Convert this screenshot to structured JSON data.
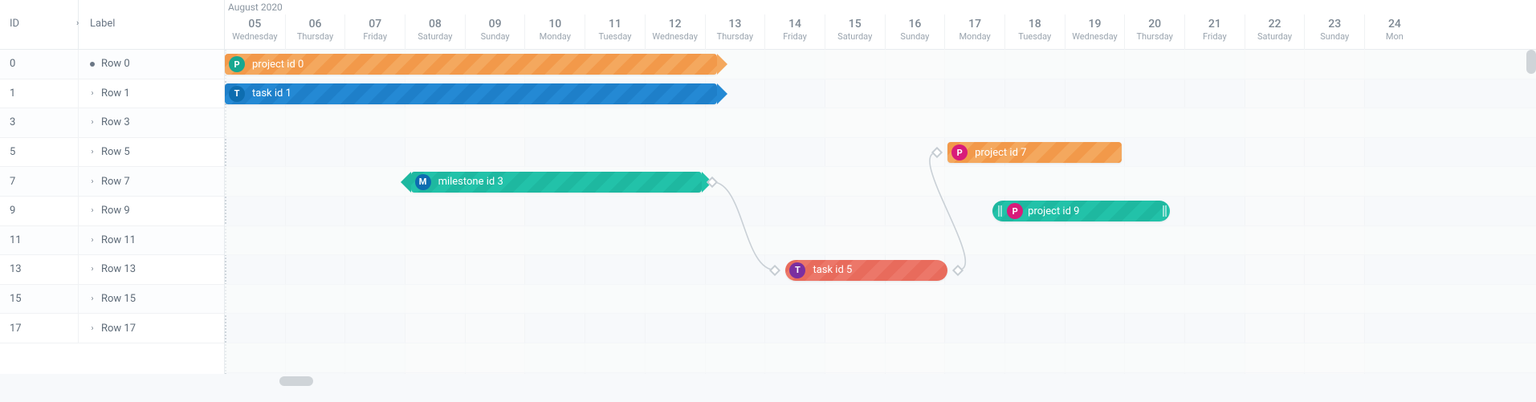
{
  "header": {
    "columns": {
      "id": "ID",
      "label": "Label"
    },
    "month": "August 2020",
    "days": [
      {
        "num": "05",
        "name": "Wednesday",
        "weekend": false
      },
      {
        "num": "06",
        "name": "Thursday",
        "weekend": false
      },
      {
        "num": "07",
        "name": "Friday",
        "weekend": false
      },
      {
        "num": "08",
        "name": "Saturday",
        "weekend": true
      },
      {
        "num": "09",
        "name": "Sunday",
        "weekend": true
      },
      {
        "num": "10",
        "name": "Monday",
        "weekend": false
      },
      {
        "num": "11",
        "name": "Tuesday",
        "weekend": false
      },
      {
        "num": "12",
        "name": "Wednesday",
        "weekend": false
      },
      {
        "num": "13",
        "name": "Thursday",
        "weekend": false
      },
      {
        "num": "14",
        "name": "Friday",
        "weekend": false
      },
      {
        "num": "15",
        "name": "Saturday",
        "weekend": true
      },
      {
        "num": "16",
        "name": "Sunday",
        "weekend": true
      },
      {
        "num": "17",
        "name": "Monday",
        "weekend": false
      },
      {
        "num": "18",
        "name": "Tuesday",
        "weekend": false
      },
      {
        "num": "19",
        "name": "Wednesday",
        "weekend": false
      },
      {
        "num": "20",
        "name": "Thursday",
        "weekend": false
      },
      {
        "num": "21",
        "name": "Friday",
        "weekend": false
      },
      {
        "num": "22",
        "name": "Saturday",
        "weekend": true
      },
      {
        "num": "23",
        "name": "Sunday",
        "weekend": true
      },
      {
        "num": "24",
        "name": "Mon",
        "weekend": false
      }
    ]
  },
  "rows": [
    {
      "id": "0",
      "label": "Row 0",
      "expander": "bullet"
    },
    {
      "id": "1",
      "label": "Row 1",
      "expander": "chev"
    },
    {
      "id": "3",
      "label": "Row 3",
      "expander": "chev"
    },
    {
      "id": "5",
      "label": "Row 5",
      "expander": "chev"
    },
    {
      "id": "7",
      "label": "Row 7",
      "expander": "chev"
    },
    {
      "id": "9",
      "label": "Row 9",
      "expander": "chev"
    },
    {
      "id": "11",
      "label": "Row 11",
      "expander": "chev"
    },
    {
      "id": "13",
      "label": "Row 13",
      "expander": "chev"
    },
    {
      "id": "15",
      "label": "Row 15",
      "expander": "chev"
    },
    {
      "id": "17",
      "label": "Row 17",
      "expander": "chev"
    }
  ],
  "bars": [
    {
      "id": "project-0",
      "row": 0,
      "label": "project id 0",
      "start_day": 0,
      "span_days": 8.2,
      "color": "orange",
      "shape": "arrow-right",
      "icon": {
        "letter": "P",
        "bg": "teal"
      }
    },
    {
      "id": "task-1",
      "row": 1,
      "label": "task id 1",
      "start_day": 0,
      "span_days": 8.2,
      "color": "blue",
      "shape": "arrow-right",
      "icon": {
        "letter": "T",
        "bg": "blue"
      }
    },
    {
      "id": "project-7",
      "row": 3,
      "label": "project id 7",
      "start_day": 12.05,
      "span_days": 2.9,
      "color": "orange",
      "shape": "rect",
      "icon": {
        "letter": "P",
        "bg": "magenta"
      }
    },
    {
      "id": "milestone-3",
      "row": 4,
      "label": "milestone id 3",
      "start_day": 3.1,
      "span_days": 4.85,
      "color": "teal",
      "shape": "arrow-both",
      "icon": {
        "letter": "M",
        "bg": "blue"
      }
    },
    {
      "id": "project-9",
      "row": 5,
      "label": "project id 9",
      "start_day": 12.8,
      "span_days": 2.95,
      "color": "teal",
      "shape": "round-grip",
      "icon": {
        "letter": "P",
        "bg": "magenta"
      }
    },
    {
      "id": "task-5",
      "row": 7,
      "label": "task id 5",
      "start_day": 9.35,
      "span_days": 2.7,
      "color": "red",
      "shape": "rounded",
      "icon": {
        "letter": "T",
        "bg": "purple"
      }
    }
  ],
  "dependencies": [
    {
      "from": "milestone-3",
      "from_side": "end",
      "to": "task-5",
      "to_side": "start"
    },
    {
      "from": "task-5",
      "from_side": "end",
      "to": "project-7",
      "to_side": "start"
    }
  ],
  "colors": {
    "orange": "#f2994a",
    "blue": "#1e7fc9",
    "teal": "#1eb8a0",
    "red": "#e86b5c",
    "icon_teal": "#17a790",
    "icon_blue": "#0d6db0",
    "icon_purple": "#7b2fa0",
    "icon_magenta": "#d81b7a"
  }
}
